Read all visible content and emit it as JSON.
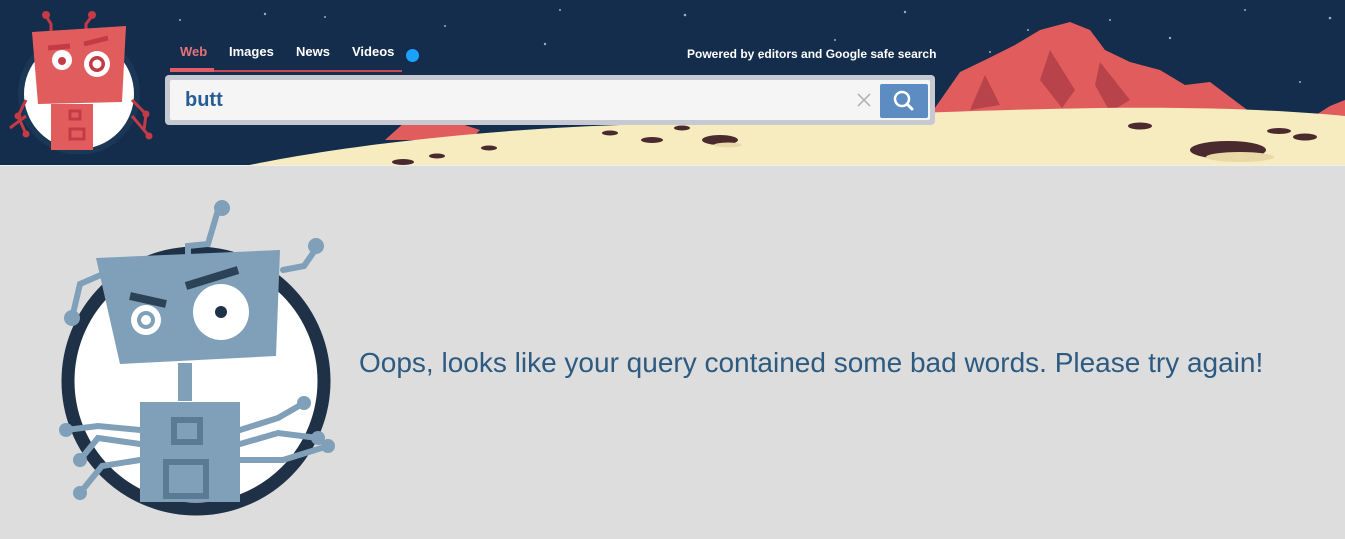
{
  "nav": {
    "tabs": [
      {
        "label": "Web",
        "active": true
      },
      {
        "label": "Images",
        "active": false
      },
      {
        "label": "News",
        "active": false
      },
      {
        "label": "Videos",
        "active": false
      }
    ]
  },
  "header": {
    "powered_by": "Powered by editors and Google safe search"
  },
  "search": {
    "value": "butt",
    "clear_icon": "close-icon",
    "submit_icon": "search-icon"
  },
  "main": {
    "message": "Oops, looks like your query contained some bad words. Please try again!"
  },
  "colors": {
    "header_bg": "#142d4c",
    "active_tab": "#e8727a",
    "search_button": "#5c8cc1",
    "message_text": "#2c5a80",
    "page_bg": "#dddddd"
  }
}
